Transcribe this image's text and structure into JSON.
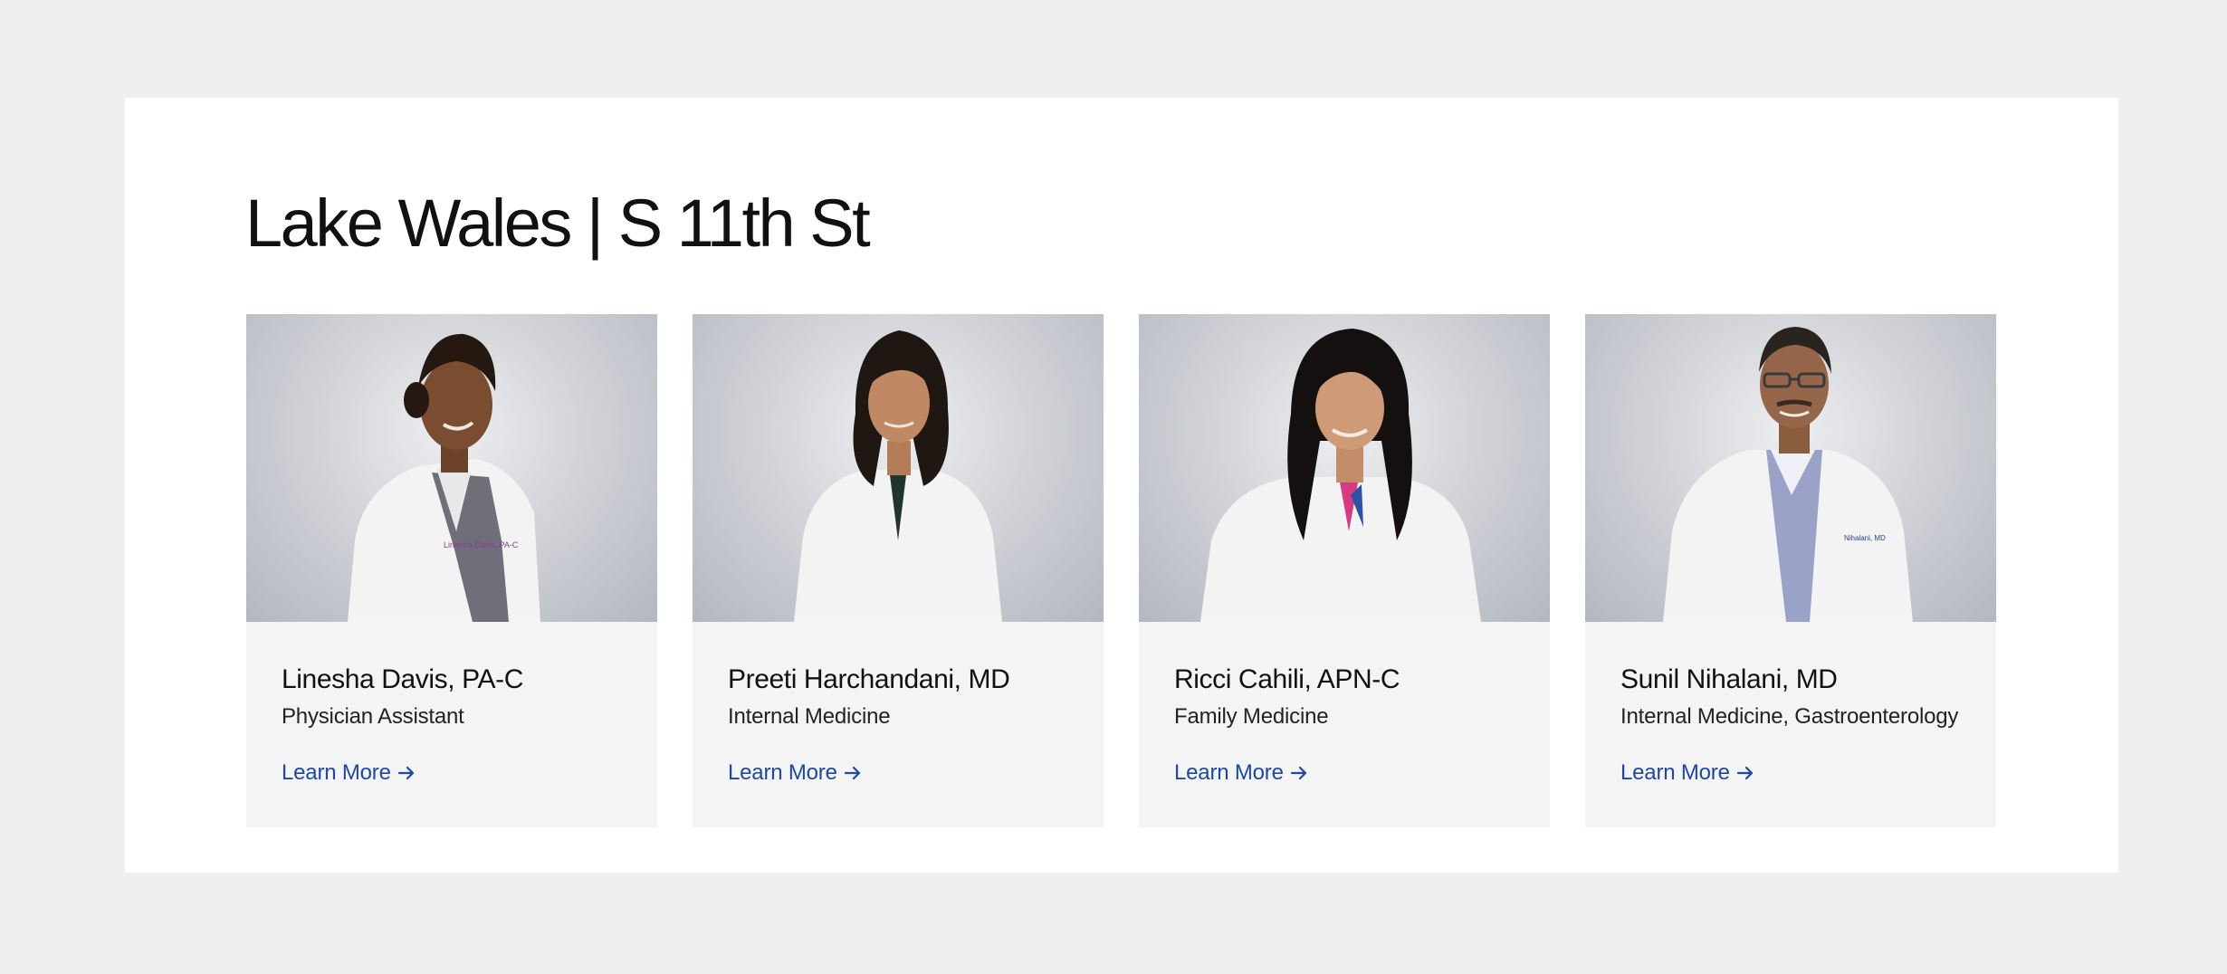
{
  "section": {
    "title": "Lake Wales | S 11th St"
  },
  "providers": [
    {
      "name": "Linesha Davis, PA-C",
      "specialty": "Physician Assistant",
      "link_label": "Learn More"
    },
    {
      "name": "Preeti Harchandani, MD",
      "specialty": "Internal Medicine",
      "link_label": "Learn More"
    },
    {
      "name": "Ricci Cahili, APN-C",
      "specialty": "Family Medicine",
      "link_label": "Learn More"
    },
    {
      "name": "Sunil Nihalani, MD",
      "specialty": "Internal Medicine, Gastroenterology",
      "link_label": "Learn More"
    }
  ],
  "icons": {
    "link_arrow": "arrow-right-icon"
  },
  "colors": {
    "page_background": "#efefef",
    "panel_background": "#ffffff",
    "card_background": "#f4f4f4",
    "link": "#1d47a8",
    "text": "#111111"
  }
}
